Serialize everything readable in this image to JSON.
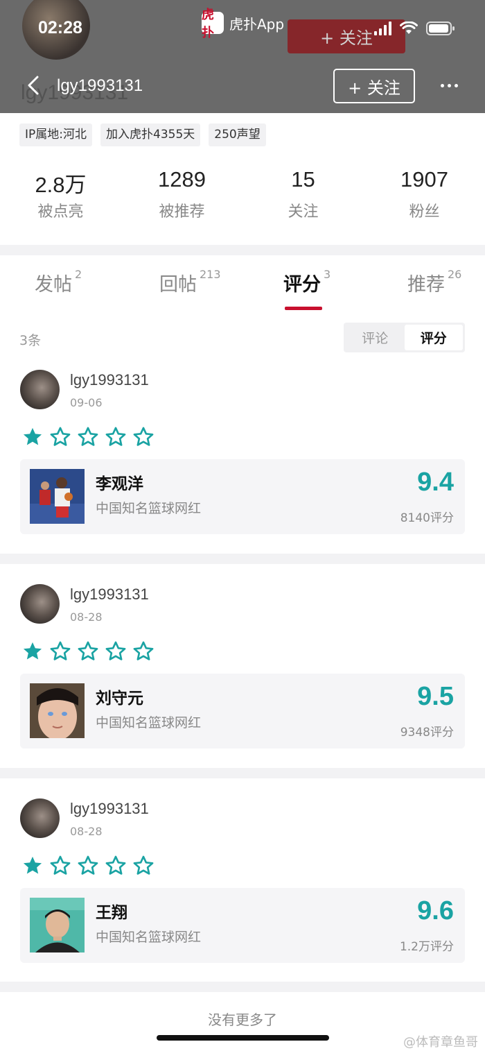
{
  "status_bar": {
    "time": "02:28"
  },
  "app": {
    "name": "虎扑App",
    "logo_char": "虎扑"
  },
  "header": {
    "ghost_follow": "+ 关注",
    "username": "lgy1993131",
    "ghost_username": "lgy1993131",
    "follow_label": "+ 关注"
  },
  "profile": {
    "tags": [
      "IP属地:河北",
      "加入虎扑4355天",
      "250声望"
    ],
    "stats": [
      {
        "value": "2.8万",
        "label": "被点亮"
      },
      {
        "value": "1289",
        "label": "被推荐"
      },
      {
        "value": "15",
        "label": "关注"
      },
      {
        "value": "1907",
        "label": "粉丝"
      }
    ]
  },
  "tabs": [
    {
      "label": "发帖",
      "count": "2"
    },
    {
      "label": "回帖",
      "count": "213"
    },
    {
      "label": "评分",
      "count": "3"
    },
    {
      "label": "推荐",
      "count": "26"
    }
  ],
  "list": {
    "count_label": "3条",
    "segments": [
      "评论",
      "评分"
    ],
    "entries": [
      {
        "user": "lgy1993131",
        "date": "09-06",
        "stars": 1,
        "stars_total": 5,
        "card": {
          "title": "李观洋",
          "subtitle": "中国知名篮球网红",
          "score": "9.4",
          "count": "8140评分"
        }
      },
      {
        "user": "lgy1993131",
        "date": "08-28",
        "stars": 1,
        "stars_total": 5,
        "card": {
          "title": "刘守元",
          "subtitle": "中国知名篮球网红",
          "score": "9.5",
          "count": "9348评分"
        }
      },
      {
        "user": "lgy1993131",
        "date": "08-28",
        "stars": 1,
        "stars_total": 5,
        "card": {
          "title": "王翔",
          "subtitle": "中国知名篮球网红",
          "score": "9.6",
          "count": "1.2万评分"
        }
      }
    ]
  },
  "footer": {
    "no_more": "没有更多了",
    "watermark": "@体育章鱼哥"
  },
  "colors": {
    "accent": "#c8102e",
    "score": "#1aa3a3",
    "star": "#1aa3a3"
  }
}
